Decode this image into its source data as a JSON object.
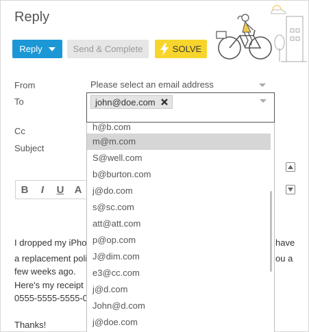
{
  "header": {
    "title": "Reply"
  },
  "toolbar": {
    "reply_label": "Reply",
    "send_complete_label": "Send & Complete",
    "solve_label": "SOLVE"
  },
  "form": {
    "from_label": "From",
    "from_placeholder": "Please select an email address",
    "to_label": "To",
    "to_chip": "john@doe.com",
    "cc_label": "Cc",
    "subject_label": "Subject"
  },
  "dropdown": {
    "options": [
      "h@b.com",
      "m@m.com",
      "S@well.com",
      "b@burton.com",
      "j@do.com",
      "s@sc.com",
      "att@att.com",
      "p@op.com",
      "J@dim.com",
      "e3@cc.com",
      "j@d.com",
      "John@d.com",
      "j@doe.com"
    ],
    "highlighted": "m@m.com"
  },
  "editor": {
    "bold": "B",
    "italic": "I",
    "underline": "U",
    "more": "A"
  },
  "message": {
    "line1_left": "I dropped my iPho",
    "line1_right": "have",
    "line2_left": "a replacement poli",
    "line2_right": "ou a",
    "line3": "few weeks ago.",
    "line4": "Here's my receipt",
    "line5": "0555-5555-5555-0",
    "line6": "Thanks!"
  },
  "colors": {
    "reply_button": "#1b97d5",
    "solve_button": "#f7d52c",
    "send_button": "#e6e6e6",
    "highlight_row": "#d6d6d6"
  }
}
